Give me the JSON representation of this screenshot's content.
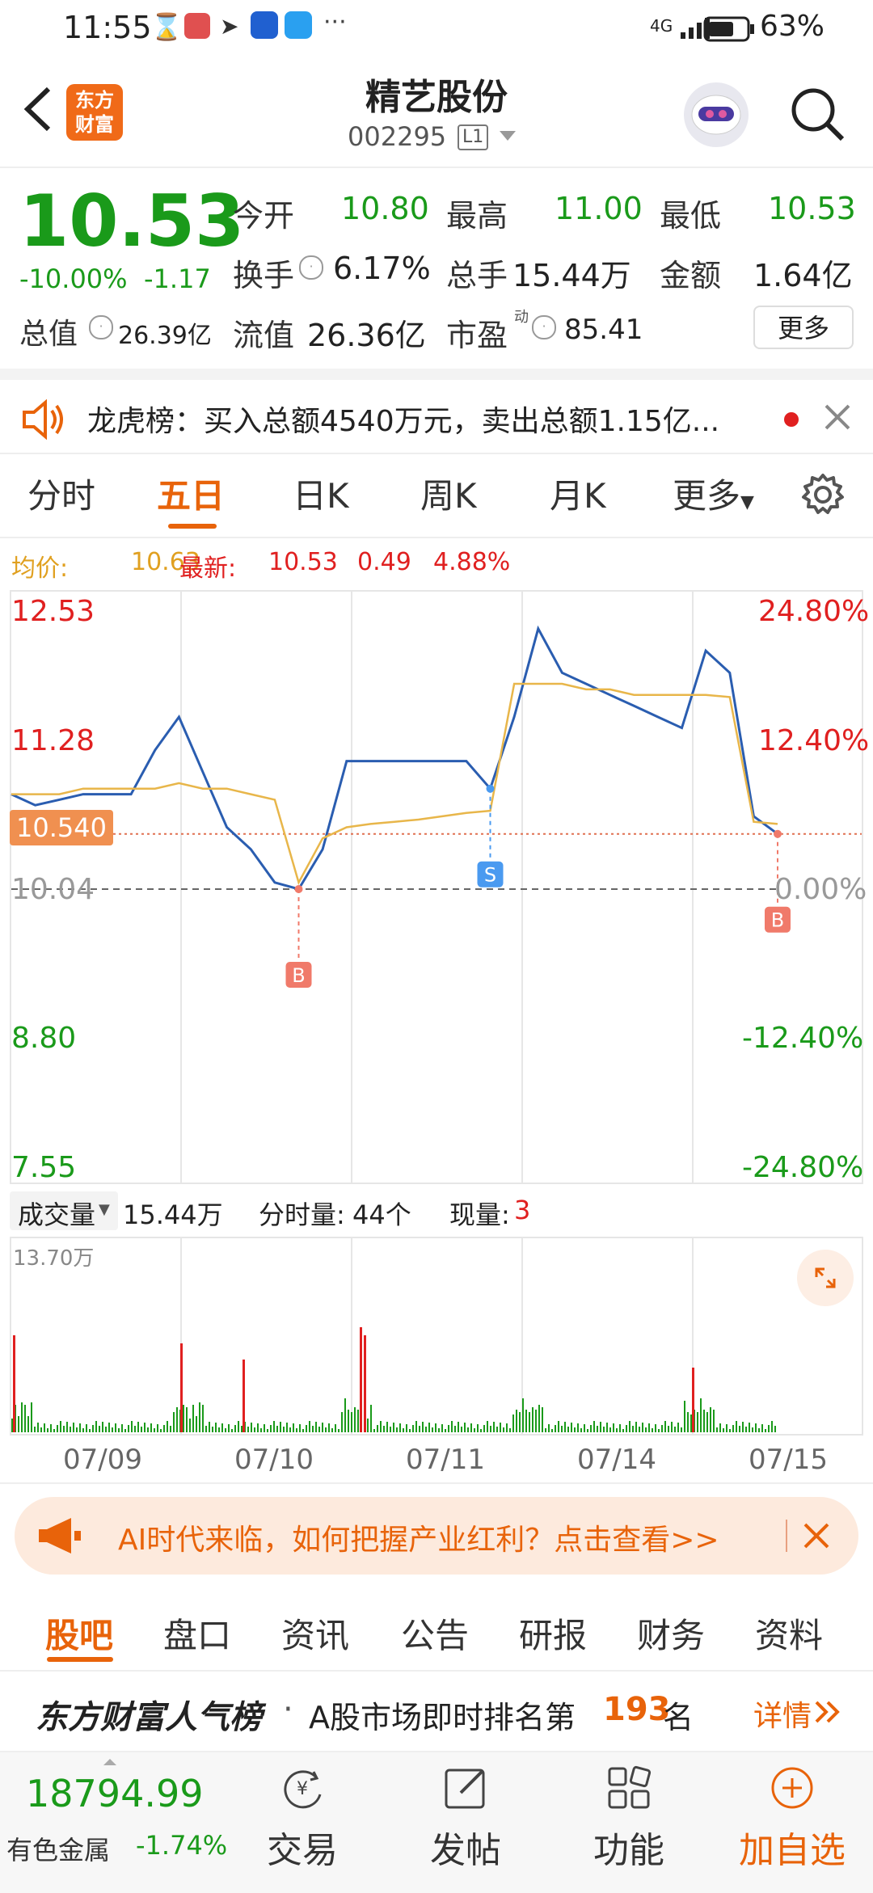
{
  "status": {
    "time": "11:55",
    "network": "4G",
    "battery": "63%"
  },
  "header": {
    "app_logo": "东方财富",
    "stock_name": "精艺股份",
    "stock_code": "002295",
    "level": "L1"
  },
  "quote": {
    "price": "10.53",
    "change_pct": "-10.00%",
    "change": "-1.17",
    "open_label": "今开",
    "open": "10.80",
    "high_label": "最高",
    "high": "11.00",
    "low_label": "最低",
    "low": "10.53",
    "turnover_label": "换手",
    "turnover": "6.17%",
    "volume_label": "总手",
    "volume": "15.44万",
    "amount_label": "金额",
    "amount": "1.64亿",
    "mktcap_label": "总值",
    "mktcap": "26.39亿",
    "float_label": "流值",
    "float": "26.36亿",
    "pe_label": "市盈",
    "pe_sup": "动",
    "pe": "85.41",
    "more_button": "更多"
  },
  "notice": {
    "text": "龙虎榜：买入总额4540万元，卖出总额1.15亿..."
  },
  "chart_tabs": [
    "分时",
    "五日",
    "日K",
    "周K",
    "月K",
    "更多"
  ],
  "active_tab": "五日",
  "legend": {
    "avg_label": "均价:",
    "avg": "10.63",
    "latest_label": "最新:",
    "latest": "10.53",
    "chg": "0.49",
    "chg_pct": "4.88%"
  },
  "chart_data": {
    "type": "line",
    "y_ticks": [
      "12.53",
      "11.28",
      "10.04",
      "8.80",
      "7.55"
    ],
    "y_pct_ticks": [
      "24.80%",
      "12.40%",
      "0.00%",
      "-12.40%",
      "-24.80%"
    ],
    "current_marker": "10.540",
    "x": [
      "07/09",
      "07/10",
      "07/11",
      "07/14",
      "07/15"
    ],
    "ylim": [
      7.55,
      12.53
    ],
    "series": [
      {
        "values": [
          10.9,
          10.8,
          10.85,
          10.9,
          10.9,
          10.9,
          11.3,
          11.6,
          11.1,
          10.6,
          10.4,
          10.1,
          10.04,
          10.4,
          11.2,
          11.2,
          11.2,
          11.2,
          11.2,
          11.2,
          10.95,
          11.6,
          12.4,
          12.0,
          11.9,
          11.8,
          11.7,
          11.6,
          11.5,
          12.2,
          12.0,
          10.7,
          10.54
        ]
      },
      {
        "values": [
          10.9,
          10.9,
          10.9,
          10.95,
          10.95,
          10.95,
          10.95,
          11.0,
          10.95,
          10.95,
          10.9,
          10.85,
          10.1,
          10.5,
          10.6,
          10.63,
          10.65,
          10.67,
          10.7,
          10.73,
          10.75,
          11.9,
          11.9,
          11.9,
          11.85,
          11.85,
          11.8,
          11.8,
          11.8,
          11.8,
          11.78,
          10.65,
          10.63
        ]
      }
    ],
    "markers": [
      "B",
      "S",
      "B"
    ],
    "volume_label": "成交量",
    "volume_total": "15.44万",
    "minute_vol_label": "分时量:",
    "minute_vol": "44个",
    "cur_vol_label": "现量:",
    "cur_vol": "3",
    "volume_max": "13.70万"
  },
  "ad": {
    "text": "AI时代来临，如何把握产业红利？点击查看>>"
  },
  "bottom_tabs": [
    "股吧",
    "盘口",
    "资讯",
    "公告",
    "研报",
    "财务",
    "资料"
  ],
  "rank": {
    "brand": "东方财富人气榜",
    "dot": "·",
    "prefix": "A股市场即时排名第",
    "rank": "193",
    "suffix": "名",
    "detail": "详情"
  },
  "footer": {
    "index_value": "18794.99",
    "index_name": "有色金属",
    "index_chg": "-1.74%",
    "trade": "交易",
    "post": "发帖",
    "func": "功能",
    "add": "加自选"
  },
  "colors": {
    "accent": "#e8630a",
    "up": "#e02020",
    "down": "#1a9a1a",
    "price_line": "#2a5db0",
    "avg_line": "#e8b64a"
  }
}
